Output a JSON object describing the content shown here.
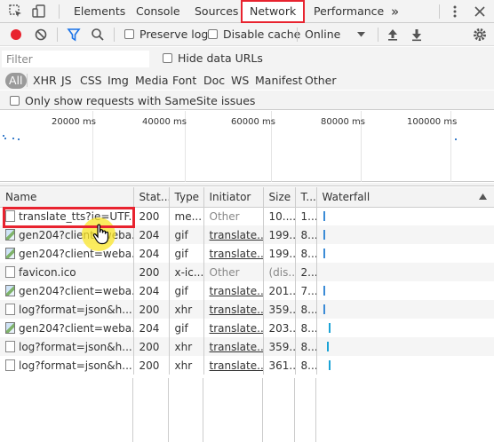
{
  "devtools_tabs": {
    "elements": "Elements",
    "console": "Console",
    "sources": "Sources",
    "network": "Network",
    "performance": "Performance",
    "overflow": "»"
  },
  "toolbar": {
    "preserve_log": "Preserve log",
    "disable_cache": "Disable cache",
    "throttling": "Online"
  },
  "filter": {
    "placeholder": "Filter",
    "hide_data_urls": "Hide data URLs"
  },
  "types": [
    "All",
    "XHR",
    "JS",
    "CSS",
    "Img",
    "Media",
    "Font",
    "Doc",
    "WS",
    "Manifest",
    "Other"
  ],
  "samesite_label": "Only show requests with SameSite issues",
  "timeline": {
    "labels": [
      "20000 ms",
      "40000 ms",
      "60000 ms",
      "80000 ms",
      "100000 ms"
    ]
  },
  "columns": [
    "Name",
    "Stat...",
    "Type",
    "Initiator",
    "Size",
    "T...",
    "Waterfall"
  ],
  "rows": [
    {
      "name": "translate_tts?ie=UTF...",
      "status": "200",
      "type": "me...",
      "initiator": "Other",
      "size": "10....",
      "time": "1...",
      "icon": "file-icon"
    },
    {
      "name": "gen204?client=weba...",
      "status": "204",
      "type": "gif",
      "initiator": "translate...",
      "size": "199...",
      "time": "8...",
      "icon": "image-icon"
    },
    {
      "name": "gen204?client=weba...",
      "status": "204",
      "type": "gif",
      "initiator": "translate...",
      "size": "199...",
      "time": "8...",
      "icon": "image-icon"
    },
    {
      "name": "favicon.ico",
      "status": "200",
      "type": "x-ic...",
      "initiator": "Other",
      "size": "(dis...",
      "time": "2...",
      "icon": "file-icon"
    },
    {
      "name": "gen204?client=weba...",
      "status": "204",
      "type": "gif",
      "initiator": "translate...",
      "size": "201...",
      "time": "7...",
      "icon": "image-icon"
    },
    {
      "name": "log?format=json&h...",
      "status": "200",
      "type": "xhr",
      "initiator": "translate...",
      "size": "359...",
      "time": "8...",
      "icon": "file-icon"
    },
    {
      "name": "gen204?client=weba...",
      "status": "204",
      "type": "gif",
      "initiator": "translate...",
      "size": "203...",
      "time": "8...",
      "icon": "image-icon"
    },
    {
      "name": "log?format=json&h...",
      "status": "200",
      "type": "xhr",
      "initiator": "translate...",
      "size": "359...",
      "time": "8...",
      "icon": "file-icon"
    },
    {
      "name": "log?format=json&h...",
      "status": "200",
      "type": "xhr",
      "initiator": "translate...",
      "size": "361...",
      "time": "8...",
      "icon": "file-icon"
    }
  ],
  "waterfall_progress": [
    0.02,
    0.02,
    0.02,
    0.0,
    0.02,
    0.02,
    0.05,
    0.04,
    0.05
  ],
  "colors": {
    "highlight": "#e8232f",
    "record": "#e8232f",
    "filter_active": "#1a73e8",
    "waterfall_bar": "#3b8bd6",
    "cursor_glow": "#fae628"
  }
}
